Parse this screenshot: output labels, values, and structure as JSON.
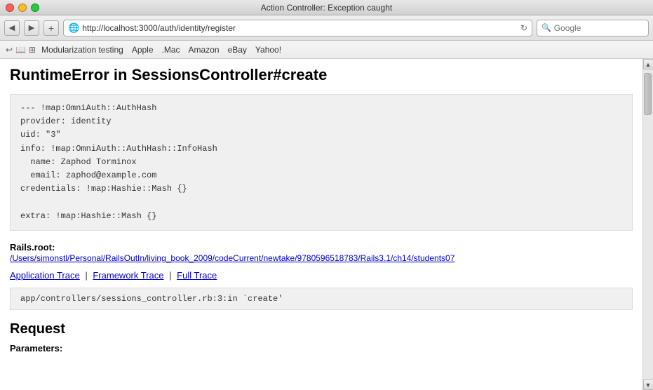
{
  "titlebar": {
    "title": "Action Controller: Exception caught"
  },
  "browser": {
    "address": "http://localhost:3000/auth/identity/register",
    "search_placeholder": "Google",
    "nav_back_label": "◀",
    "nav_forward_label": "▶",
    "add_tab_label": "+",
    "reload_label": "↻"
  },
  "bookmarks": {
    "icon_label": "⊞",
    "items": [
      {
        "label": "Modularization testing"
      },
      {
        "label": "Apple"
      },
      {
        "label": ".Mac"
      },
      {
        "label": "Amazon"
      },
      {
        "label": "eBay"
      },
      {
        "label": "Yahoo!"
      }
    ]
  },
  "content": {
    "page_title": "RuntimeError in SessionsController#create",
    "error_data": "--- !map:OmniAuth::AuthHash\nprovider: identity\nuid: \"3\"\ninfo: !map:OmniAuth::AuthHash::InfoHash\n  name: Zaphod Torminox\n  email: zaphod@example.com\ncredentials: !map:Hashie::Mash {}\n\nextra: !map:Hashie::Mash {}",
    "rails_root_label": "Rails.root:",
    "rails_root_path": "/Users/simonstl/Personal/RailsOutIn/living_book_2009/codeCurrent/newtake/9780596518783/Rails3.1/ch14/students07",
    "trace_links": {
      "application": "Application Trace",
      "framework": "Framework Trace",
      "full": "Full Trace"
    },
    "trace_content": "app/controllers/sessions_controller.rb:3:in `create'",
    "request_title": "Request",
    "params_label": "Parameters:"
  }
}
